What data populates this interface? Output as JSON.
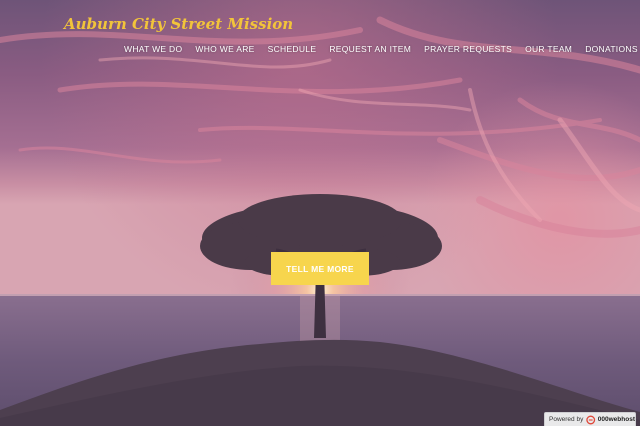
{
  "site": {
    "brand": "Auburn City Street Mission"
  },
  "nav": {
    "items": [
      {
        "label": "WHAT WE DO"
      },
      {
        "label": "WHO WE ARE"
      },
      {
        "label": "SCHEDULE"
      },
      {
        "label": "REQUEST AN ITEM"
      },
      {
        "label": "PRAYER REQUESTS"
      },
      {
        "label": "OUR TEAM"
      },
      {
        "label": "DONATIONS"
      }
    ]
  },
  "hero": {
    "cta_label": "TELL ME MORE"
  },
  "badge": {
    "prefix": "Powered by",
    "host": "000webhost",
    "icon": "webhost-logo-icon"
  },
  "colors": {
    "brand": "#f2c43a",
    "cta": "#f7d54d",
    "nav_text": "#ffffff"
  }
}
